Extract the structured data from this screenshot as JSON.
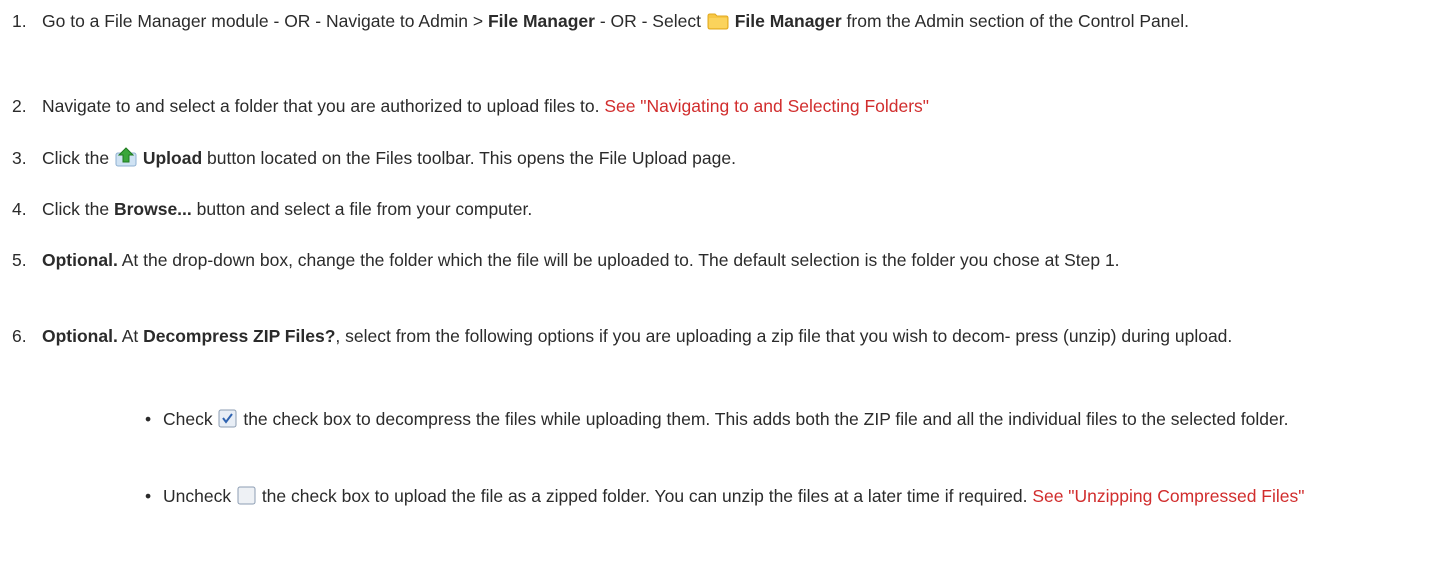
{
  "steps": [
    {
      "num": "1.",
      "t1": "Go to a File Manager module - OR - Navigate to Admin > ",
      "b1": "File Manager",
      "t2": " - OR - Select ",
      "b2": "File Manager",
      "t3": " from the Admin section of the Control Panel.",
      "icon": "folder-icon"
    },
    {
      "num": "2.",
      "t1": "Navigate to and select a folder that you are authorized to upload files to. ",
      "link": "See \"Navigating to and Selecting Folders\""
    },
    {
      "num": "3.",
      "t1": "Click the ",
      "b1": "Upload",
      "t2": " button located on the Files toolbar. This opens the File Upload page.",
      "icon": "upload-icon"
    },
    {
      "num": "4.",
      "t1": "Click the ",
      "b1": "Browse...",
      "t2": " button and select a file from your computer."
    },
    {
      "num": "5.",
      "b1": "Optional.",
      "t1": " At the drop-down box, change the folder which the file will be uploaded to. The default selection is the folder you chose at Step 1."
    },
    {
      "num": "6.",
      "b1": "Optional.",
      "t1": " At ",
      "b2": "Decompress ZIP Files?",
      "t2": ", select from the following options if you are uploading a zip file that you wish to decom- press (unzip) during upload."
    }
  ],
  "bullets": [
    {
      "t1": "Check ",
      "t2": " the check box to decompress the files while uploading them. This adds both the ZIP file and all the individual files to the selected folder.",
      "icon": "checkbox-checked-icon"
    },
    {
      "t1": "Uncheck ",
      "t2": " the check box to upload the file as a zipped folder. You can unzip the files at a later time if required. ",
      "link": "See \"Unzipping Compressed Files\"",
      "icon": "checkbox-unchecked-icon"
    }
  ],
  "colors": {
    "text": "#2b2b2b",
    "link": "#d12d2d",
    "folder": "#f7c744",
    "upload_arrow": "#3aa63a"
  }
}
